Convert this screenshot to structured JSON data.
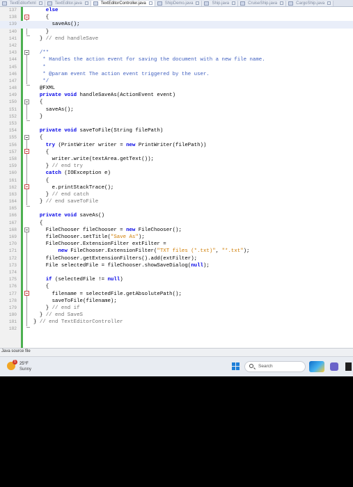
{
  "tabs": [
    {
      "label": "TextEditorfxml",
      "active": false
    },
    {
      "label": "TextEditor.java",
      "active": false
    },
    {
      "label": "TextEditorController.java",
      "active": true
    },
    {
      "label": "ShipDemo.java",
      "active": false
    },
    {
      "label": "Ship.java",
      "active": false
    },
    {
      "label": "CruiseShip.java",
      "active": false
    },
    {
      "label": "CargoShip.java",
      "active": false
    }
  ],
  "code_lines": [
    {
      "n": "137",
      "html": "    <span class=\"kw\">else</span>"
    },
    {
      "n": "138",
      "html": "    {"
    },
    {
      "n": "139",
      "html": "      saveAs();",
      "highlight": true
    },
    {
      "n": "140",
      "html": "    }"
    },
    {
      "n": "141",
      "html": "  } <span class=\"cm\">// end handleSave</span>"
    },
    {
      "n": "142",
      "html": ""
    },
    {
      "n": "143",
      "html": "  <span class=\"jd\">/**</span>"
    },
    {
      "n": "144",
      "html": "  <span class=\"jd\"> * Handles the action event for saving the document with a new file name.</span>"
    },
    {
      "n": "145",
      "html": "  <span class=\"jd\"> *</span>"
    },
    {
      "n": "146",
      "html": "  <span class=\"jd\"> * @param event The action event triggered by the user.</span>"
    },
    {
      "n": "147",
      "html": "  <span class=\"jd\"> */</span>"
    },
    {
      "n": "148",
      "html": "  <span class=\"an\">@FXML</span>"
    },
    {
      "n": "149",
      "html": "  <span class=\"kw\">private void</span> handleSaveAs(ActionEvent event)"
    },
    {
      "n": "150",
      "html": "  {"
    },
    {
      "n": "151",
      "html": "    saveAs();"
    },
    {
      "n": "152",
      "html": "  }"
    },
    {
      "n": "153",
      "html": ""
    },
    {
      "n": "154",
      "html": "  <span class=\"kw\">private void</span> saveToFile(String filePath)"
    },
    {
      "n": "155",
      "html": "  {"
    },
    {
      "n": "156",
      "html": "    <span class=\"kw\">try</span> (PrintWriter writer = <span class=\"kw\">new</span> PrintWriter(filePath))"
    },
    {
      "n": "157",
      "html": "    {"
    },
    {
      "n": "158",
      "html": "      writer.write(textArea.getText());"
    },
    {
      "n": "159",
      "html": "    } <span class=\"cm\">// end try</span>"
    },
    {
      "n": "160",
      "html": "    <span class=\"kw\">catch</span> (IOException e)"
    },
    {
      "n": "161",
      "html": "    {"
    },
    {
      "n": "162",
      "html": "      e.printStackTrace();"
    },
    {
      "n": "163",
      "html": "    } <span class=\"cm\">// end catch</span>"
    },
    {
      "n": "164",
      "html": "  } <span class=\"cm\">// end saveToFile</span>"
    },
    {
      "n": "165",
      "html": ""
    },
    {
      "n": "166",
      "html": "  <span class=\"kw\">private void</span> saveAs()"
    },
    {
      "n": "167",
      "html": "  {"
    },
    {
      "n": "168",
      "html": "    FileChooser fileChooser = <span class=\"kw\">new</span> FileChooser();"
    },
    {
      "n": "169",
      "html": "    fileChooser.setTitle(<span class=\"st\">\"Save As\"</span>);"
    },
    {
      "n": "170",
      "html": "    FileChooser.ExtensionFilter extFilter ="
    },
    {
      "n": "171",
      "html": "        <span class=\"kw\">new</span> FileChooser.ExtensionFilter(<span class=\"st\">\"TXT files (*.txt)\"</span>, <span class=\"st\">\"*.txt\"</span>);"
    },
    {
      "n": "172",
      "html": "    fileChooser.getExtensionFilters().add(extFilter);"
    },
    {
      "n": "173",
      "html": "    File selectedFile = fileChooser.showSaveDialog(<span class=\"kw\">null</span>);"
    },
    {
      "n": "174",
      "html": ""
    },
    {
      "n": "175",
      "html": "    <span class=\"kw\">if</span> (selectedFile != <span class=\"kw\">null</span>)"
    },
    {
      "n": "176",
      "html": "    {"
    },
    {
      "n": "177",
      "html": "      filename = selectedFile.getAbsolutePath();"
    },
    {
      "n": "178",
      "html": "      saveToFile(filename);"
    },
    {
      "n": "179",
      "html": "    } <span class=\"cm\">// end if</span>"
    },
    {
      "n": "180",
      "html": "  } <span class=\"cm\">// end SaveS</span>"
    },
    {
      "n": "181",
      "html": "} <span class=\"cm\">// end TextEditorController</span>"
    },
    {
      "n": "182",
      "html": ""
    }
  ],
  "status": {
    "text": "Java source file"
  },
  "weather": {
    "badge": "1",
    "temp": "25°F",
    "condition": "Sunny"
  },
  "taskbar": {
    "search_label": "Search"
  }
}
